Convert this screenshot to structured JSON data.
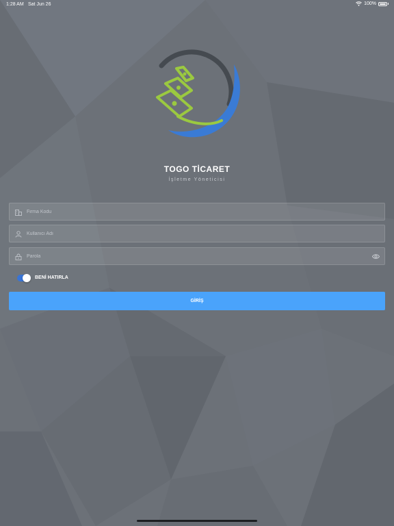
{
  "status_bar": {
    "time": "1:28 AM",
    "date": "Sat Jun 26",
    "battery": "100%"
  },
  "brand": {
    "title": "TOGO TİCARET",
    "subtitle": "İşletme Yöneticisi"
  },
  "form": {
    "company_code_placeholder": "Firma Kodu",
    "username_placeholder": "Kullanıcı Adı",
    "password_placeholder": "Parola",
    "remember_label": "BENİ HATIRLA",
    "remember_on": true,
    "login_label": "GİRİŞ"
  },
  "colors": {
    "background": "#6c7178",
    "accent": "#4aa3fb",
    "toggle": "#3874d6",
    "logo_green": "#9bc940",
    "logo_blue": "#3a7bd5"
  },
  "icons": [
    "building-icon",
    "user-icon",
    "lock-icon",
    "eye-icon",
    "wifi-icon",
    "battery-icon"
  ]
}
